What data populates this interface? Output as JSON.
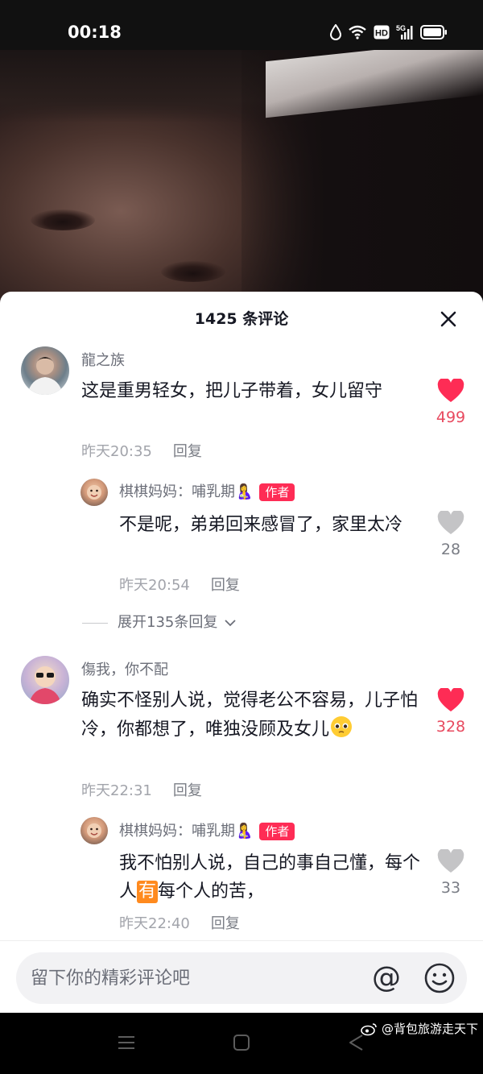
{
  "status_bar": {
    "time": "00:18",
    "icons": [
      "data-saver-icon",
      "wifi-icon",
      "hd-icon",
      "signal-5g-icon",
      "battery-icon"
    ],
    "hd_label": "HD",
    "network_label": "5G"
  },
  "comments_panel": {
    "title": "1425 条评论",
    "comments": [
      {
        "user": "龍之族",
        "text": "这是重男轻女，把儿子带着，女儿留守",
        "time": "昨天20:35",
        "reply_label": "回复",
        "likes": "499",
        "liked": true
      },
      {
        "user": "棋棋妈妈：哺乳期🤱",
        "badge": "作者",
        "text": "不是呢，弟弟回来感冒了，家里太冷",
        "time": "昨天20:54",
        "reply_label": "回复",
        "likes": "28",
        "liked": false
      },
      {
        "user": "傷我，你不配",
        "text": "确实不怪别人说，觉得老公不容易，儿子怕冷，你都想了，唯独没顾及女儿",
        "time": "昨天22:31",
        "reply_label": "回复",
        "likes": "328",
        "liked": true
      },
      {
        "user": "棋棋妈妈：哺乳期🤱",
        "badge": "作者",
        "text_before": "我不怕别人说，自己的事自己懂，每个人",
        "text_highlight": "有",
        "text_after": "每个人的苦，",
        "time": "昨天22:40",
        "reply_label": "回复",
        "likes": "33",
        "liked": false
      }
    ],
    "expand_replies": "展开135条回复"
  },
  "input_bar": {
    "placeholder": "留下你的精彩评论吧",
    "at_symbol": "@"
  },
  "watermark": "@背包旅游走天下",
  "colors": {
    "like_active": "#fe2c55",
    "like_inactive": "#c4c4c6",
    "author_badge": "#fe2c55",
    "highlight": "#ff8a1e"
  }
}
